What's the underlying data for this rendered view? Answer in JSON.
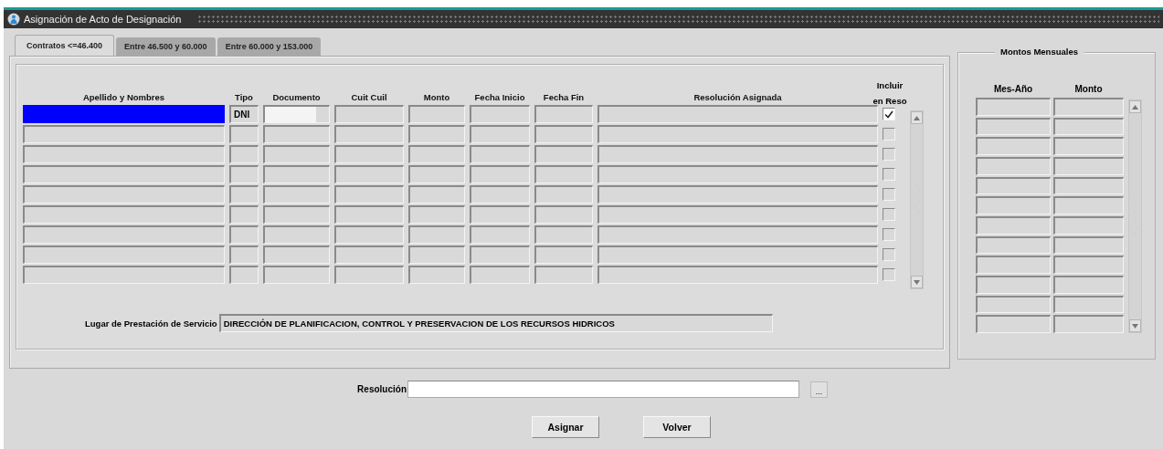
{
  "window": {
    "title": "Asignación de Acto de Designación"
  },
  "tabs": [
    {
      "label": "Contratos <=46.400",
      "selected": true
    },
    {
      "label": "Entre 46.500 y 60.000",
      "selected": false
    },
    {
      "label": "Entre 60.000 y 153.000",
      "selected": false
    }
  ],
  "contracts_table": {
    "columns": [
      "Apellido y Nombres",
      "Tipo",
      "Documento",
      "Cuit Cuil",
      "Monto",
      "Fecha Inicio",
      "Fecha Fin",
      "Resolución Asignada"
    ],
    "checkbox_column": "Incluir en Reso",
    "rows": [
      {
        "selected": true,
        "tipo": "DNI",
        "included": true
      },
      {
        "selected": false,
        "included": false
      },
      {
        "selected": false,
        "included": false
      },
      {
        "selected": false,
        "included": false
      },
      {
        "selected": false,
        "included": false
      },
      {
        "selected": false,
        "included": false
      },
      {
        "selected": false,
        "included": false
      },
      {
        "selected": false,
        "included": false
      },
      {
        "selected": false,
        "included": false
      }
    ]
  },
  "service_place": {
    "label": "Lugar de Prestación de Servicio",
    "value": "DIRECCIÓN DE PLANIFICACION, CONTROL Y PRESERVACION DE LOS RECURSOS HIDRICOS"
  },
  "monthly_amounts": {
    "title": "Montos Mensuales",
    "columns": [
      "Mes-Año",
      "Monto"
    ]
  },
  "resolution": {
    "label": "Resolución",
    "lov_button": "..."
  },
  "buttons": [
    "Asignar",
    "Volver"
  ]
}
